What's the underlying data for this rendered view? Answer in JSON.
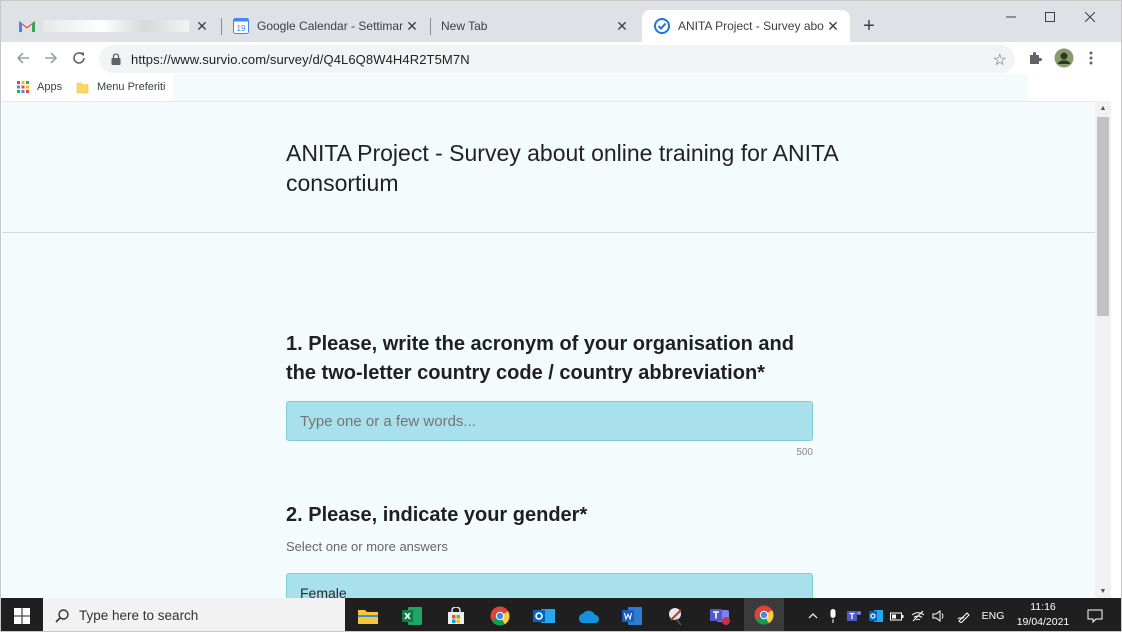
{
  "browser": {
    "tabs": [
      {
        "title": "",
        "favicon": "gmail-icon",
        "redacted": true
      },
      {
        "title": "Google Calendar - Settimana del",
        "favicon": "calendar-icon",
        "favicon_text": "19"
      },
      {
        "title": "New Tab",
        "favicon": ""
      },
      {
        "title": "ANITA Project - Survey about onl",
        "favicon": "survio-icon",
        "active": true
      }
    ],
    "new_tab": "+",
    "url": "https://www.survio.com/survey/d/Q4L6Q8W4H4R2T5M7N",
    "bookmarks": [
      {
        "label": "Apps",
        "icon": "apps-grid-icon"
      },
      {
        "label": "Menu Preferiti",
        "icon": "folder-icon"
      }
    ]
  },
  "survey": {
    "title": "ANITA Project - Survey about online training for ANITA consortium",
    "questions": [
      {
        "title": "1. Please, write the acronym of your organisation and the two-letter country code / country abbreviation*",
        "placeholder": "Type one or a few words...",
        "char_limit": "500"
      },
      {
        "title": "2. Please, indicate your gender*",
        "hint": "Select one or more answers",
        "answers": [
          "Female"
        ]
      }
    ]
  },
  "taskbar": {
    "search_placeholder": "Type here to search",
    "language": "ENG",
    "time": "11:16",
    "date": "19/04/2021"
  },
  "colors": {
    "page_background": "#f3fbfd",
    "input_fill": "#a8e0ec",
    "taskbar": "#1f1f1f"
  }
}
